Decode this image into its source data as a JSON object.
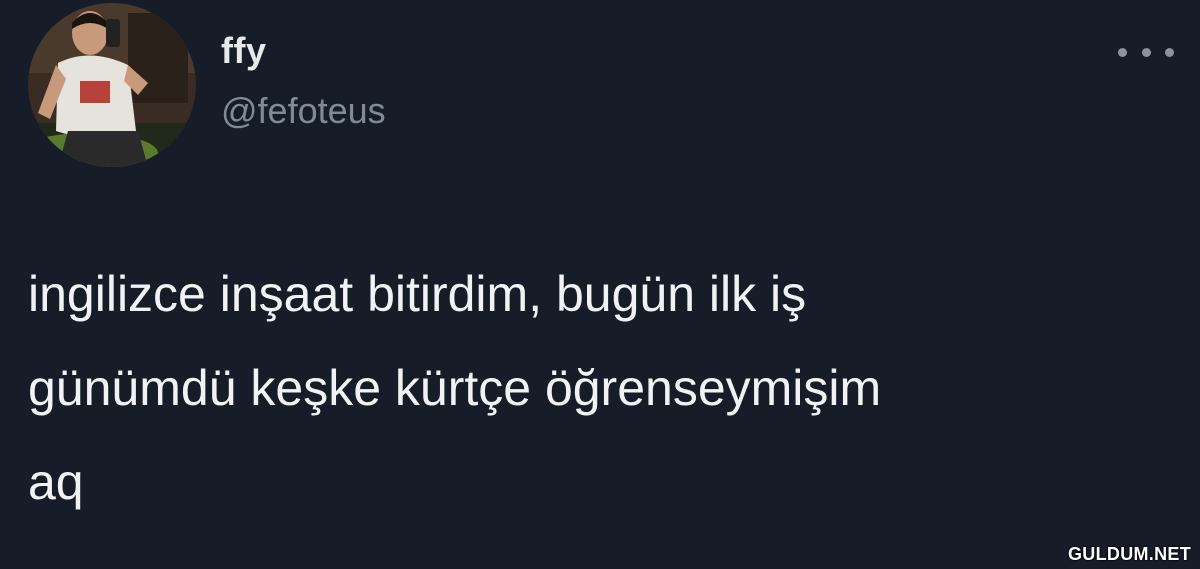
{
  "author": {
    "display_name": "ffy",
    "handle": "@fefoteus"
  },
  "tweet": {
    "lines": [
      "ingilizce inşaat bitirdim, bugün ilk iş",
      "günümdü keşke kürtçe öğrenseymişim",
      "aq"
    ]
  },
  "icons": {
    "more": "more-horizontal-icon"
  },
  "watermark": "GULDUM.NET",
  "colors": {
    "background": "#171d28",
    "name": "#e7e9ea",
    "handle": "#7f8b97",
    "text": "#f1f2f3"
  }
}
